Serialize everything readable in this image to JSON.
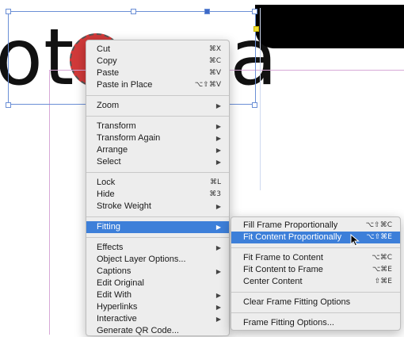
{
  "canvas": {
    "big_text": "ote ara"
  },
  "context_menu": {
    "groups": [
      [
        {
          "label": "Cut",
          "shortcut": "⌘X"
        },
        {
          "label": "Copy",
          "shortcut": "⌘C"
        },
        {
          "label": "Paste",
          "shortcut": "⌘V"
        },
        {
          "label": "Paste in Place",
          "shortcut": "⌥⇧⌘V"
        }
      ],
      [
        {
          "label": "Zoom",
          "submenu": true
        }
      ],
      [
        {
          "label": "Transform",
          "submenu": true
        },
        {
          "label": "Transform Again",
          "submenu": true
        },
        {
          "label": "Arrange",
          "submenu": true
        },
        {
          "label": "Select",
          "submenu": true
        }
      ],
      [
        {
          "label": "Lock",
          "shortcut": "⌘L"
        },
        {
          "label": "Hide",
          "shortcut": "⌘3"
        },
        {
          "label": "Stroke Weight",
          "submenu": true
        }
      ],
      [
        {
          "label": "Fitting",
          "submenu": true,
          "highlighted": true
        }
      ],
      [
        {
          "label": "Effects",
          "submenu": true
        },
        {
          "label": "Object Layer Options..."
        },
        {
          "label": "Captions",
          "submenu": true
        },
        {
          "label": "Edit Original"
        },
        {
          "label": "Edit With",
          "submenu": true
        },
        {
          "label": "Hyperlinks",
          "submenu": true
        },
        {
          "label": "Interactive",
          "submenu": true
        },
        {
          "label": "Generate QR Code..."
        }
      ]
    ]
  },
  "fitting_submenu": {
    "groups": [
      [
        {
          "label": "Fill Frame Proportionally",
          "shortcut": "⌥⇧⌘C"
        },
        {
          "label": "Fit Content Proportionally",
          "shortcut": "⌥⇧⌘E",
          "highlighted": true
        }
      ],
      [
        {
          "label": "Fit Frame to Content",
          "shortcut": "⌥⌘C"
        },
        {
          "label": "Fit Content to Frame",
          "shortcut": "⌥⌘E"
        },
        {
          "label": "Center Content",
          "shortcut": "⇧⌘E"
        }
      ],
      [
        {
          "label": "Clear Frame Fitting Options"
        }
      ],
      [
        {
          "label": "Frame Fitting Options..."
        }
      ]
    ]
  },
  "icons": {
    "submenu_arrow": "submenu-arrow-icon",
    "pointer": "mouse-pointer-icon"
  },
  "colors": {
    "highlight": "#3d7fd9",
    "menu_bg": "#ededed",
    "selection": "#6b8fd6",
    "red_circle": "#d13a3a"
  }
}
